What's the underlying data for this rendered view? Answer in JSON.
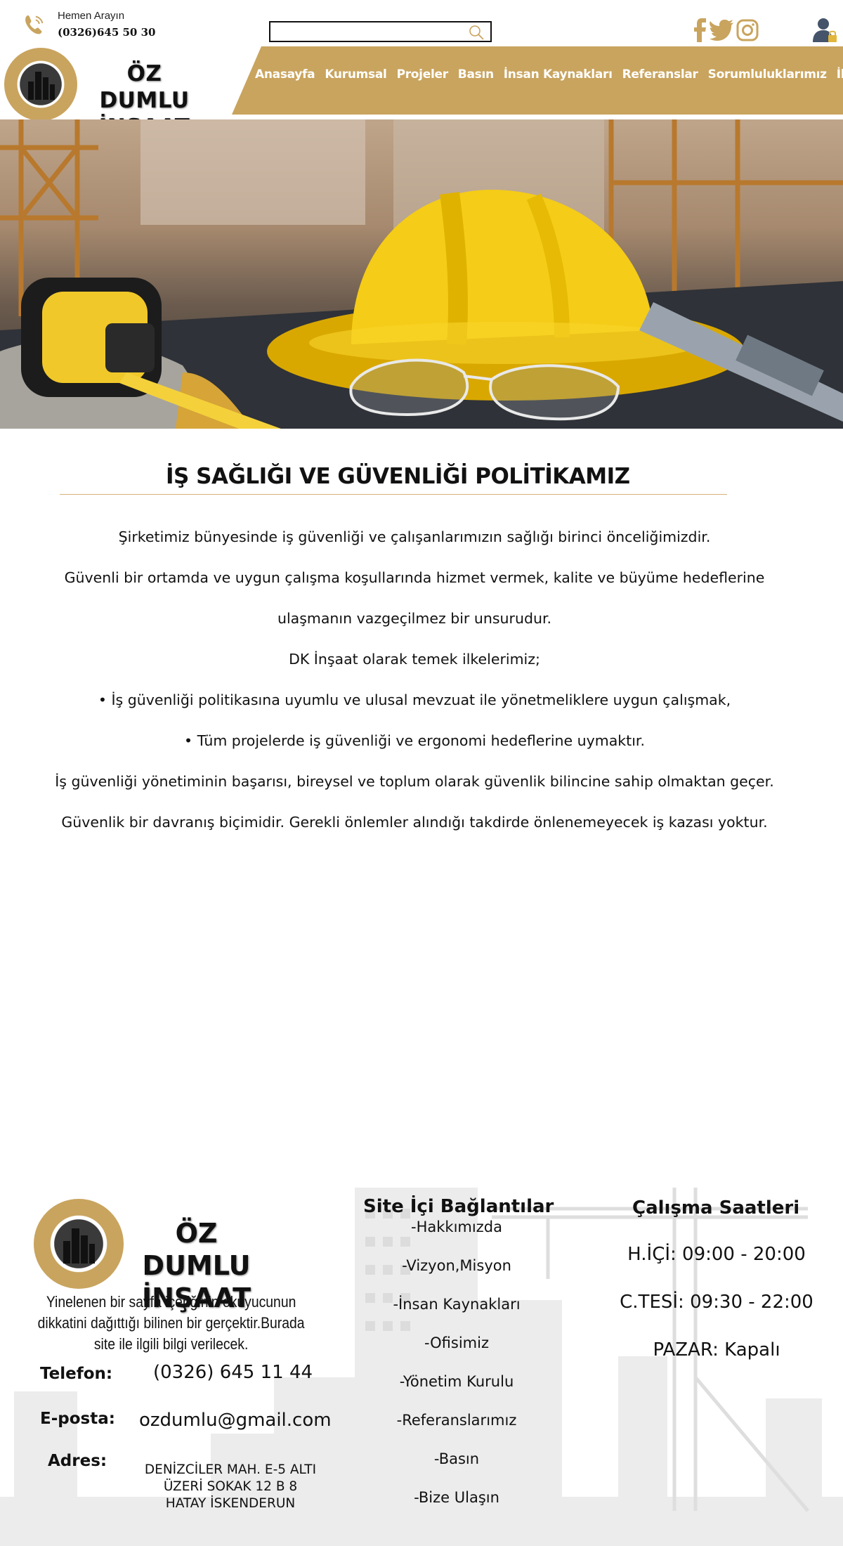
{
  "header": {
    "call_label": "Hemen Arayın",
    "call_number": "(0326)645 50 30",
    "search": {
      "value": "",
      "placeholder": ""
    },
    "logo_line1": "ÖZ DUMLU",
    "logo_line2": "İNŞAAT",
    "social": [
      "facebook-icon",
      "twitter-icon",
      "instagram-icon"
    ]
  },
  "nav": {
    "items": [
      {
        "label": "Anasayfa"
      },
      {
        "label": "Kurumsal"
      },
      {
        "label": "Projeler"
      },
      {
        "label": "Basın"
      },
      {
        "label": "İnsan Kaynakları"
      },
      {
        "label": "Referanslar"
      },
      {
        "label": "Sorumluluklarımız"
      },
      {
        "label": "İletişim"
      }
    ]
  },
  "content": {
    "title": "İŞ SAĞLIĞI VE GÜVENLİĞİ POLİTİKAMIZ",
    "paragraphs": [
      "Şirketimiz bünyesinde iş güvenliği ve çalışanlarımızın sağlığı birinci önceliğimizdir.",
      "Güvenli bir ortamda ve uygun çalışma koşullarında hizmet vermek, kalite ve büyüme hedeflerine",
      "ulaşmanın vazgeçilmez bir unsurudur.",
      "DK İnşaat olarak temek ilkelerimiz;",
      "• İş güvenliği politikasına uyumlu ve ulusal mevzuat ile yönetmeliklere uygun çalışmak,",
      "• Tüm projelerde iş güvenliği ve ergonomi hedeflerine uymaktır.",
      "İş güvenliği yönetiminin başarısı, bireysel ve toplum olarak güvenlik bilincine sahip olmaktan geçer.",
      "Güvenlik bir davranış biçimidir. Gerekli önlemler alındığı takdirde önlenemeyecek iş kazası yoktur."
    ]
  },
  "footer": {
    "logo_line1": "ÖZ DUMLU",
    "logo_line2": "İNŞAAT",
    "description": "Yinelenen bir sayfa içeriğinin okuyucunun dikkatini dağıttığı bilinen bir gerçektir.Burada site ile ilgili  bilgi verilecek.",
    "phone_label": "Telefon:",
    "phone_value": "(0326) 645 11 44",
    "email_label": "E-posta:",
    "email_value": "ozdumlu@gmail.com",
    "address_label": "Adres:",
    "address_line1": "DENİZCİLER MAH. E-5 ALTI",
    "address_line2": "ÜZERİ SOKAK 12 B 8",
    "address_line3": "HATAY İSKENDERUN",
    "links_title": "Site İçi Bağlantılar",
    "links": [
      {
        "label": "-Hakkımızda"
      },
      {
        "label": "-Vizyon,Misyon"
      },
      {
        "label": "-İnsan Kaynakları"
      },
      {
        "label": "-Ofisimiz"
      },
      {
        "label": "-Yönetim Kurulu"
      },
      {
        "label": "-Referanslarımız"
      },
      {
        "label": "-Basın"
      },
      {
        "label": "-Bize Ulaşın"
      }
    ],
    "hours_title": "Çalışma Saatleri",
    "hours": [
      {
        "label": "H.İÇİ: 09:00 - 20:00"
      },
      {
        "label": "C.TESİ: 09:30 - 22:00"
      },
      {
        "label": "PAZAR: Kapalı"
      }
    ]
  },
  "colors": {
    "accent_gold": "#c9a45e",
    "social_gold": "#c9a45e",
    "rule": "#d8b27a"
  }
}
